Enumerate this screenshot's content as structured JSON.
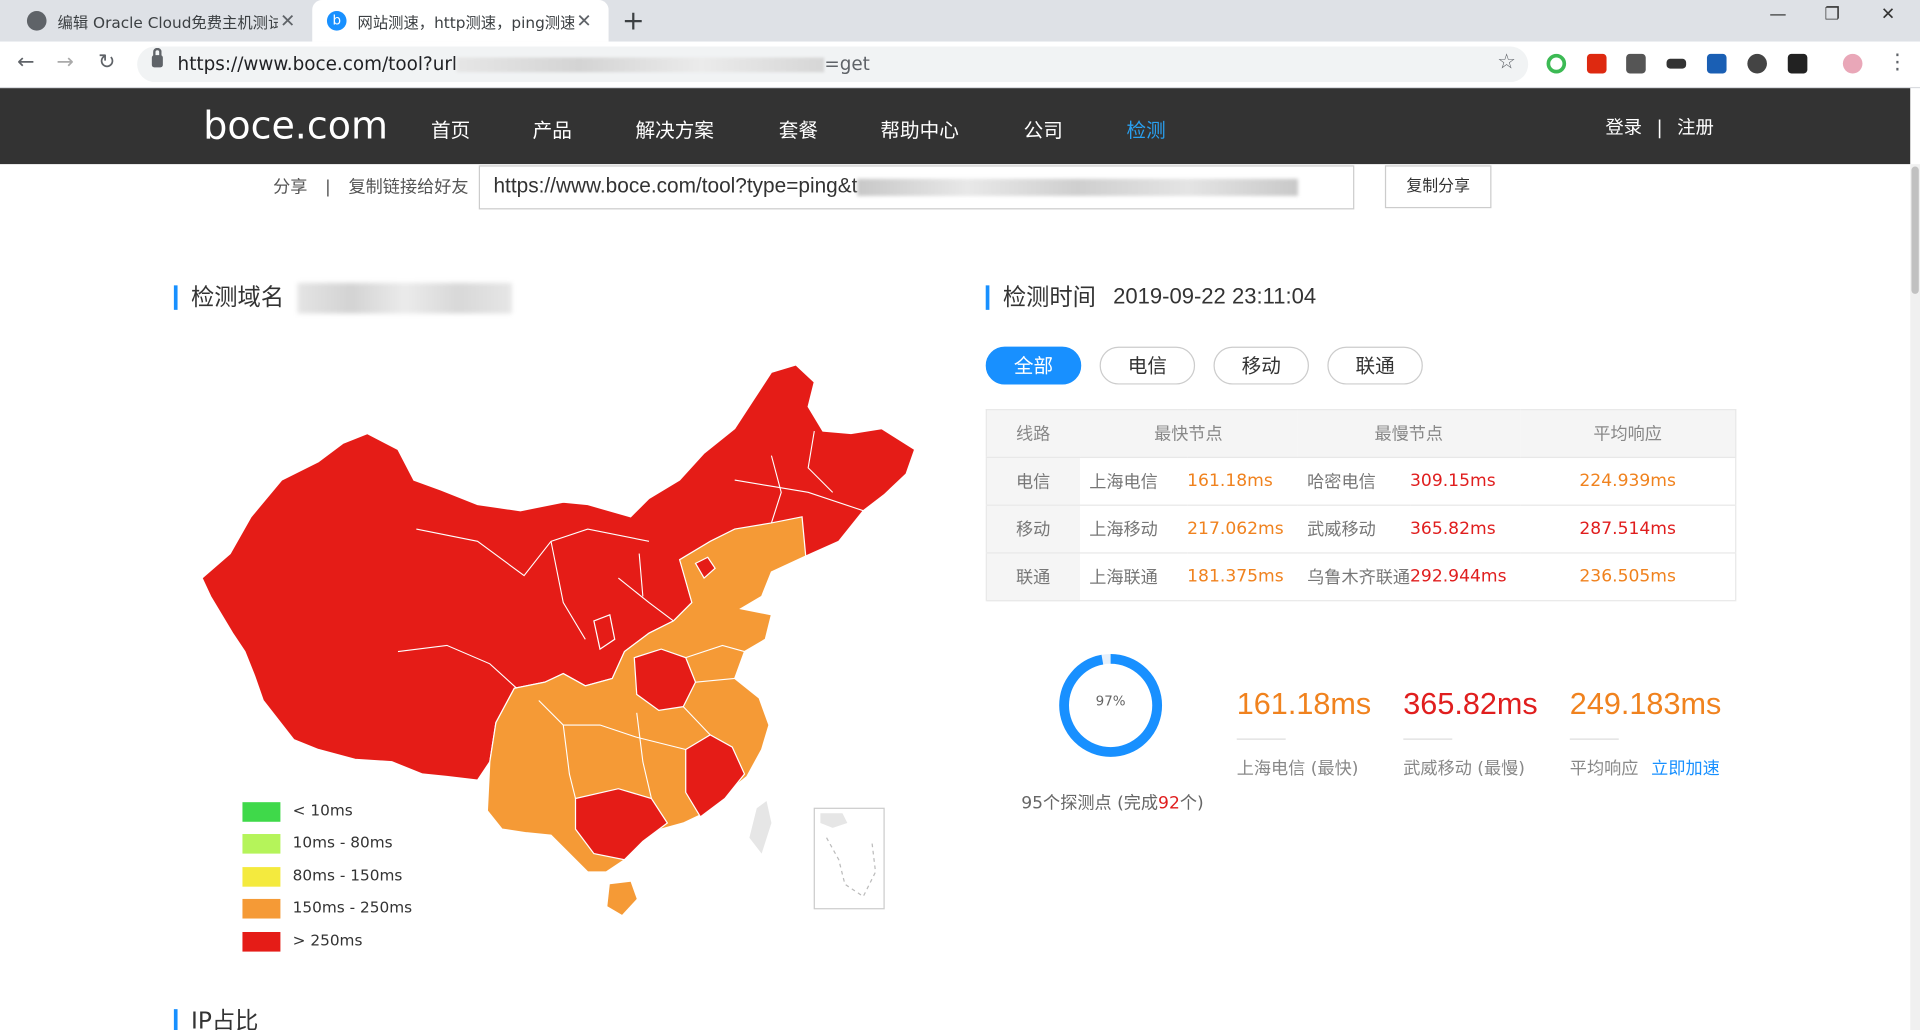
{
  "browser": {
    "tabs": [
      {
        "title": "编辑 Oracle Cloud免费主机测试",
        "active": false
      },
      {
        "title": "网站测速，http测速，ping测速",
        "active": true
      }
    ],
    "url_prefix": "https://www.boce.com/tool?url",
    "url_suffix": "=get",
    "icons": [
      "back-icon",
      "forward-icon",
      "reload-icon",
      "lock-icon",
      "star-icon",
      "new-tab-icon",
      "minimize-icon",
      "maximize-icon",
      "close-window-icon"
    ]
  },
  "site": {
    "logo": "boce.com",
    "nav": [
      "首页",
      "产品",
      "解决方案",
      "套餐",
      "帮助中心",
      "公司",
      "检测"
    ],
    "active_nav": "检测",
    "login": "登录",
    "separator": "|",
    "register": "注册"
  },
  "share": {
    "label": "分享",
    "separator": "|",
    "link_label": "复制链接给好友",
    "url": "https://www.boce.com/tool?type=ping&t",
    "copy_button": "复制分享"
  },
  "domain_section": {
    "title": "检测域名"
  },
  "time_section": {
    "title": "检测时间",
    "value": "2019-09-22 23:11:04"
  },
  "filters": [
    "全部",
    "电信",
    "移动",
    "联通"
  ],
  "active_filter": "全部",
  "table": {
    "headers": [
      "线路",
      "最快节点",
      "最慢节点",
      "平均响应"
    ],
    "rows": [
      {
        "line": "电信",
        "fast_node": "上海电信",
        "fast_ms": "161.18ms",
        "slow_node": "哈密电信",
        "slow_ms": "309.15ms",
        "avg_ms": "224.939ms"
      },
      {
        "line": "移动",
        "fast_node": "上海移动",
        "fast_ms": "217.062ms",
        "slow_node": "武威移动",
        "slow_ms": "365.82ms",
        "avg_ms": "287.514ms"
      },
      {
        "line": "联通",
        "fast_node": "上海联通",
        "fast_ms": "181.375ms",
        "slow_node": "乌鲁木齐联通",
        "slow_ms": "292.944ms",
        "avg_ms": "236.505ms"
      }
    ]
  },
  "stats": {
    "progress_label": "97%",
    "progress": 0.97,
    "probe_prefix": "95个探测点 (完成",
    "probe_done": "92",
    "probe_suffix": "个)",
    "fastest": "161.18ms",
    "fastest_caption": "上海电信 (最快)",
    "slowest": "365.82ms",
    "slowest_caption": "武威移动 (最慢)",
    "average": "249.183ms",
    "average_caption": "平均响应",
    "accelerate": "立即加速"
  },
  "legend": [
    {
      "label": "< 10ms",
      "color": "#3fd94a"
    },
    {
      "label": "10ms - 80ms",
      "color": "#b5f45a"
    },
    {
      "label": "80ms - 150ms",
      "color": "#f4ea3e"
    },
    {
      "label": "150ms - 250ms",
      "color": "#f59a36"
    },
    {
      "label": "> 250ms",
      "color": "#e51c17"
    }
  ],
  "next_section": {
    "title": "IP占比"
  },
  "colors": {
    "accent": "#1890ff",
    "nav_bg": "#333333",
    "fast": "#f0821e",
    "slow": "#e01e1e",
    "map_red": "#e51c17",
    "map_orange": "#f59a36"
  }
}
